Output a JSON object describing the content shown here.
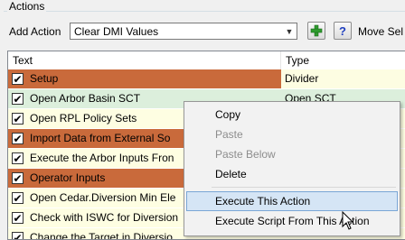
{
  "group": {
    "title": "Actions"
  },
  "toolbar": {
    "add_action_label": "Add Action",
    "action_combo_value": "Clear DMI Values",
    "add_button_icon": "plus-icon",
    "help_button_label": "?",
    "move_label": "Move Sel"
  },
  "table": {
    "headers": {
      "text": "Text",
      "type": "Type"
    },
    "rows": [
      {
        "text": "Setup",
        "type": "Divider",
        "checked": true
      },
      {
        "text": "Open Arbor Basin SCT",
        "type": "Open SCT",
        "checked": true
      },
      {
        "text": "Open RPL Policy Sets",
        "type": "",
        "checked": true
      },
      {
        "text": "Import Data from External So",
        "type": "",
        "checked": true
      },
      {
        "text": "Execute the Arbor Inputs Fron",
        "type": "",
        "checked": true
      },
      {
        "text": "Operator Inputs",
        "type": "",
        "checked": true
      },
      {
        "text": "Open Cedar.Diversion Min Ele",
        "type": "",
        "checked": true
      },
      {
        "text": "Check with ISWC for Diversion",
        "type": "",
        "checked": true
      },
      {
        "text": "Change the Target in Diversio",
        "type": "",
        "checked": true
      }
    ]
  },
  "context_menu": {
    "items": {
      "copy": "Copy",
      "paste": "Paste",
      "paste_below": "Paste Below",
      "delete": "Delete",
      "execute_action": "Execute This Action",
      "execute_script": "Execute Script From This Action"
    }
  },
  "colors": {
    "divider_row": "#c96a3b",
    "normal_row": "#fefee2",
    "selected_row": "#dcefdc",
    "menu_hover": "#d5e5f5",
    "add_icon_green": "#2e9b2e",
    "help_icon_blue": "#1f3fbf"
  }
}
